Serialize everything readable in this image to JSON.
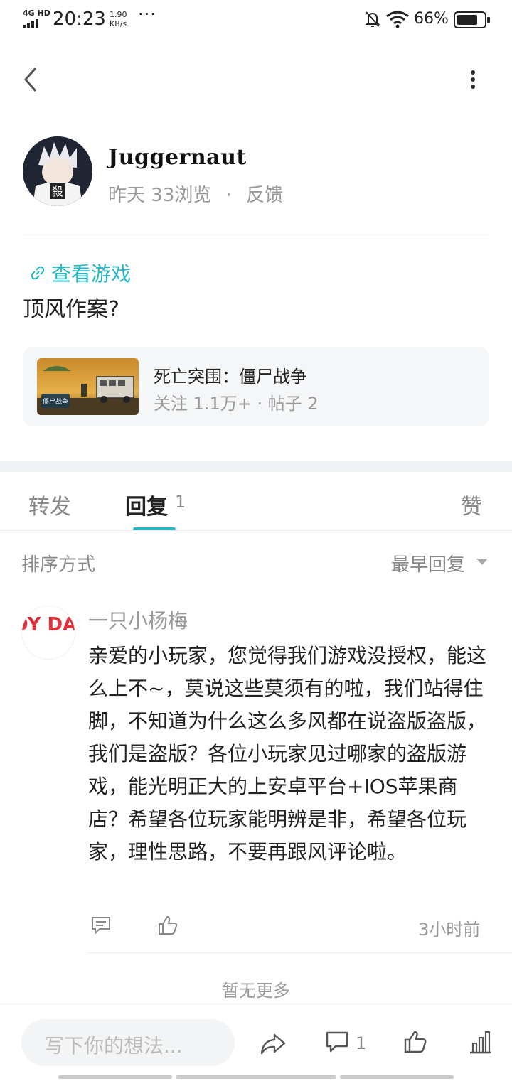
{
  "status_bar": {
    "network": "4G HD",
    "time": "20:23",
    "speed_value": "1.90",
    "speed_unit": "KB/s",
    "battery_percent": "66%"
  },
  "author": {
    "name": "Juggernaut",
    "date": "昨天",
    "views": "33浏览",
    "separator": "·",
    "feedback": "反馈"
  },
  "post": {
    "game_link_label": "查看游戏",
    "title": "顶风作案?"
  },
  "game_card": {
    "name": "死亡突围：僵尸战争",
    "stats": "关注 1.1万+  ·  帖子 2",
    "thumb_text": "僵尸战争"
  },
  "tabs": {
    "forward": "转发",
    "reply": "回复",
    "reply_count": "1",
    "like": "赞"
  },
  "sort": {
    "label": "排序方式",
    "value": "最早回复"
  },
  "comment": {
    "author": "一只小杨梅",
    "avatar_text": "JOY DAR",
    "body": "亲爱的小玩家，您觉得我们游戏没授权，能这么上不~，莫说这些莫须有的啦，我们站得住脚，不知道为什么这么多风都在说盗版盗版，我们是盗版？各位小玩家见过哪家的盗版游戏，能光明正大的上安卓平台+IOS苹果商店？希望各位玩家能明辨是非，希望各位玩家，理性思路，不要再跟风评论啦。",
    "time": "3小时前"
  },
  "list_end": "暂无更多",
  "bottom_bar": {
    "input_placeholder": "写下你的想法...",
    "comment_count": "1"
  },
  "colors": {
    "accent": "#23b8c4",
    "muted_text": "#999999",
    "card_bg": "#f4f6f8"
  }
}
